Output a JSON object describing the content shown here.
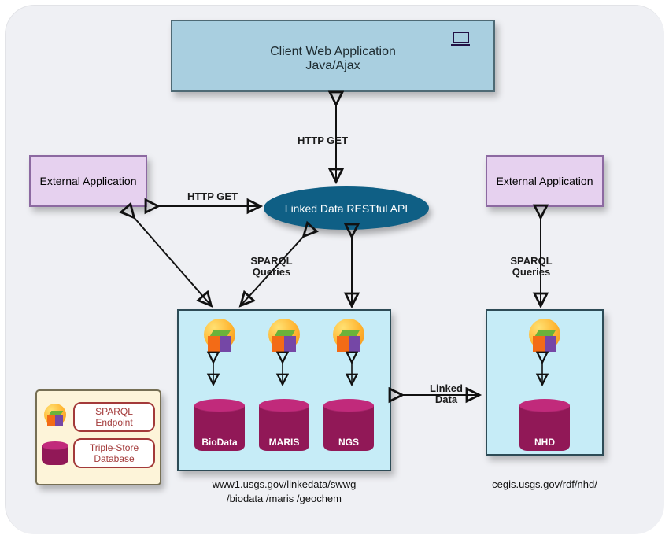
{
  "client": {
    "line1": "Client Web Application",
    "line2": "Java/Ajax"
  },
  "ext_left": "External Application",
  "ext_right": "External Application",
  "api": "Linked Data RESTful API",
  "labels": {
    "http_get_top": "HTTP GET",
    "http_get_left": "HTTP GET",
    "sparql_left": "SPARQL\nQueries",
    "sparql_right": "SPARQL\nQueries",
    "linked_data": "Linked\nData"
  },
  "left_ds": {
    "dbs": [
      "BioData",
      "MARIS",
      "NGS"
    ],
    "url": "www1.usgs.gov/linkedata/swwg\n/biodata /maris /geochem"
  },
  "right_ds": {
    "dbs": [
      "NHD"
    ],
    "url": "cegis.usgs.gov/rdf/nhd/"
  },
  "legend": {
    "endpoint": "SPARQL\nEndpoint",
    "store": "Triple-Store\nDatabase"
  }
}
